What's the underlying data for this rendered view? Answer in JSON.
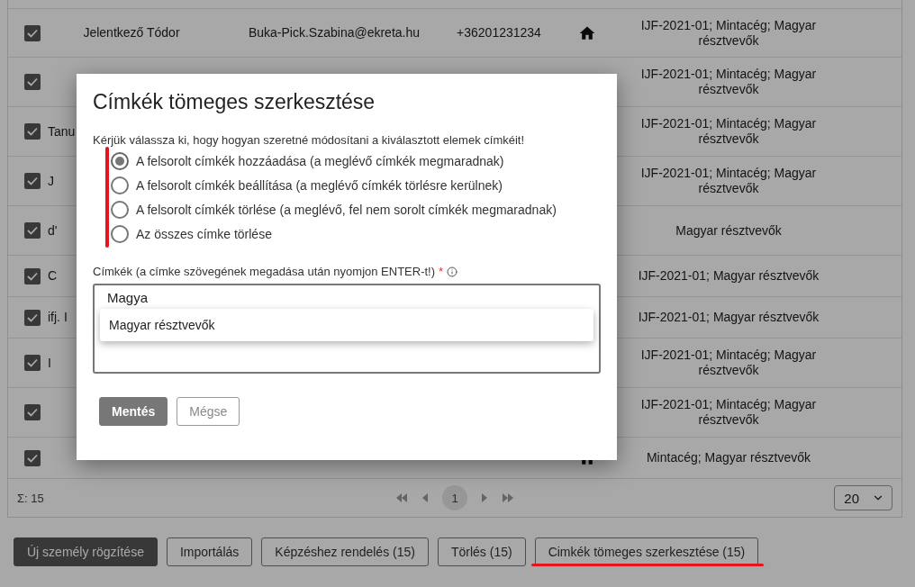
{
  "table": {
    "rows": [
      {
        "checked": true,
        "name": "Jelentkező Tódor",
        "email": "Buka-Pick.Szabina@ekreta.hu",
        "phone": "+36201231234",
        "home": true,
        "tags": "IJF-2021-01; Mintacég; Magyar résztvevők"
      },
      {
        "checked": true,
        "tags": "IJF-2021-01; Mintacég; Magyar résztvevők"
      },
      {
        "checked": true,
        "name": "Tanu",
        "clipped": true,
        "tags": "IJF-2021-01; Mintacég; Magyar résztvevők"
      },
      {
        "checked": true,
        "name": "J",
        "clipped": true,
        "tags": "IJF-2021-01; Mintacég; Magyar résztvevők"
      },
      {
        "checked": true,
        "name": "d'",
        "clipped": true,
        "tags": "Magyar résztvevők"
      },
      {
        "checked": true,
        "name": "C",
        "clipped": true,
        "tags": "IJF-2021-01; Magyar résztvevők"
      },
      {
        "checked": true,
        "name": "ifj. I",
        "clipped": true,
        "tags": "IJF-2021-01; Magyar résztvevők"
      },
      {
        "checked": true,
        "name": "I",
        "clipped": true,
        "tags": "IJF-2021-01; Mintacég; Magyar résztvevők"
      },
      {
        "checked": true,
        "tags": "IJF-2021-01; Mintacég; Magyar résztvevők"
      },
      {
        "checked": true,
        "home": true,
        "tags": "Mintacég; Magyar résztvevők"
      }
    ]
  },
  "footer": {
    "total": "Σ: 15",
    "page": "1",
    "page_size": "20"
  },
  "actions": [
    {
      "label": "Új személy rögzítése",
      "kind": "primary"
    },
    {
      "label": "Importálás",
      "kind": "outline"
    },
    {
      "label": "Képzéshez rendelés (15)",
      "kind": "outline"
    },
    {
      "label": "Törlés (15)",
      "kind": "outline"
    },
    {
      "label": "Cimkék tömeges szerkesztése (15)",
      "kind": "outline"
    }
  ],
  "dialog": {
    "title": "Címkék tömeges szerkesztése",
    "prompt": "Kérjük válassza ki, hogy hogyan szeretné módosítani a kiválasztott elemek címkéit!",
    "options": [
      {
        "label": "A felsorolt címkék hozzáadása (a meglévő címkék megmaradnak)",
        "selected": true
      },
      {
        "label": "A felsorolt címkék beállítása (a meglévő címkék törlésre kerülnek)",
        "selected": false
      },
      {
        "label": "A felsorolt címkék törlése (a meglévő, fel nem sorolt címkék megmaradnak)",
        "selected": false
      },
      {
        "label": "Az összes címke törlése",
        "selected": false
      }
    ],
    "field_label": "Címkék (a címke szövegének megadása után nyomjon ENTER-t!)",
    "required_mark": "*",
    "value": "Magya",
    "suggestions": [
      "Magyar résztvevők"
    ],
    "buttons": [
      {
        "label": "Mentés",
        "kind": "primary"
      },
      {
        "label": "Mégse",
        "kind": "outline"
      }
    ]
  }
}
